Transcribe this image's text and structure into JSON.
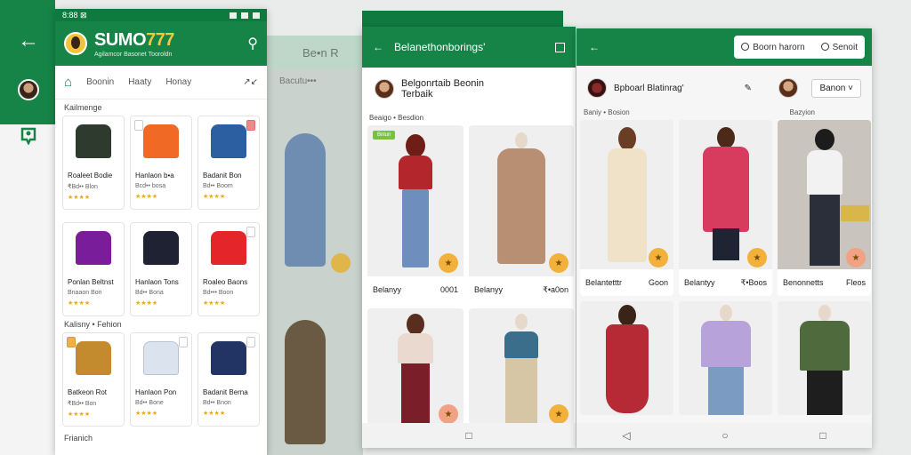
{
  "left": {
    "back_icon": "arrow-left-icon",
    "pin_icon": "map-pin-icon"
  },
  "bg": {
    "title": "Be•n  R",
    "label": "Bacutu•••"
  },
  "phone1": {
    "status_time": "8:88 ⊠",
    "brand_main": "SUMO",
    "brand_num": "777",
    "tagline": "Agilamcor Basonet Tooroldn",
    "tabs": [
      "Boonin",
      "Haaty",
      "Honay"
    ],
    "section1": "Kailmenge",
    "section2": "Kalisny • Fehion",
    "section3": "Frianich",
    "cards_top": [
      {
        "name": "Roaleet Bodie",
        "sub": "₹Bd•• Blon",
        "stars": "★★★★",
        "color": "#2f3a2f"
      },
      {
        "name": "Hanlaon b•a",
        "sub": "Bcd•• bosa",
        "stars": "★★★★",
        "color": "#f06a25"
      },
      {
        "name": "Badanit Bon",
        "sub": "Bd•• Boom",
        "stars": "★★★★",
        "color": "#2c5fa1"
      }
    ],
    "cards_mid": [
      {
        "name": "Ponlan Beltnst",
        "sub": "Bnaaon Bon",
        "stars": "★★★★",
        "color": "#7a1d9b"
      },
      {
        "name": "Hanlaon Tons",
        "sub": "Bd•• Bona",
        "stars": "★★★★",
        "color": "#1f2233"
      },
      {
        "name": "Roaleo Baons",
        "sub": "Bd••• Boon",
        "stars": "★★★★",
        "color": "#e4262a"
      }
    ],
    "cards_bot": [
      {
        "name": "Batkeon Rot",
        "sub": "₹Bd•• Bon",
        "stars": "★★★★",
        "color": "#c48a2e"
      },
      {
        "name": "Hanlaon Pon",
        "sub": "Bd•• Bone",
        "stars": "★★★★",
        "color": "#dbe3ef"
      },
      {
        "name": "Badanit Berna",
        "sub": "Bd•• Bnon",
        "stars": "★★★★",
        "color": "#213463"
      }
    ]
  },
  "phone2": {
    "title": "Belanethonborings'",
    "profile_line1": "Belgonrtaib Beonin",
    "profile_line2": "Terbaik",
    "section": "Beaigo •  Besdion",
    "badge": "Bnlun",
    "products": [
      {
        "name": "Belanyy",
        "price": "0001"
      },
      {
        "name": "Belanyy",
        "price": "₹•a0on"
      },
      {
        "name": "",
        "price": ""
      },
      {
        "name": "",
        "price": ""
      }
    ]
  },
  "phone3": {
    "search_label": "Boorn harorn",
    "search_label2": "Senoit",
    "profile": "Bpboarl Blatinrag'",
    "dropdown": "Banon",
    "section_left": "Baniy • Bosion",
    "section_right": "Bazyion",
    "products": [
      {
        "name": "Belantetttr",
        "price": "Goon"
      },
      {
        "name": "Belantyy",
        "price": "₹•Boos"
      },
      {
        "name": "Benonnetts",
        "price": "Fleos"
      },
      {
        "name": "",
        "price": ""
      },
      {
        "name": "",
        "price": ""
      },
      {
        "name": "",
        "price": ""
      }
    ]
  },
  "nav": {
    "back": "◁",
    "home": "○",
    "recent": "□"
  }
}
